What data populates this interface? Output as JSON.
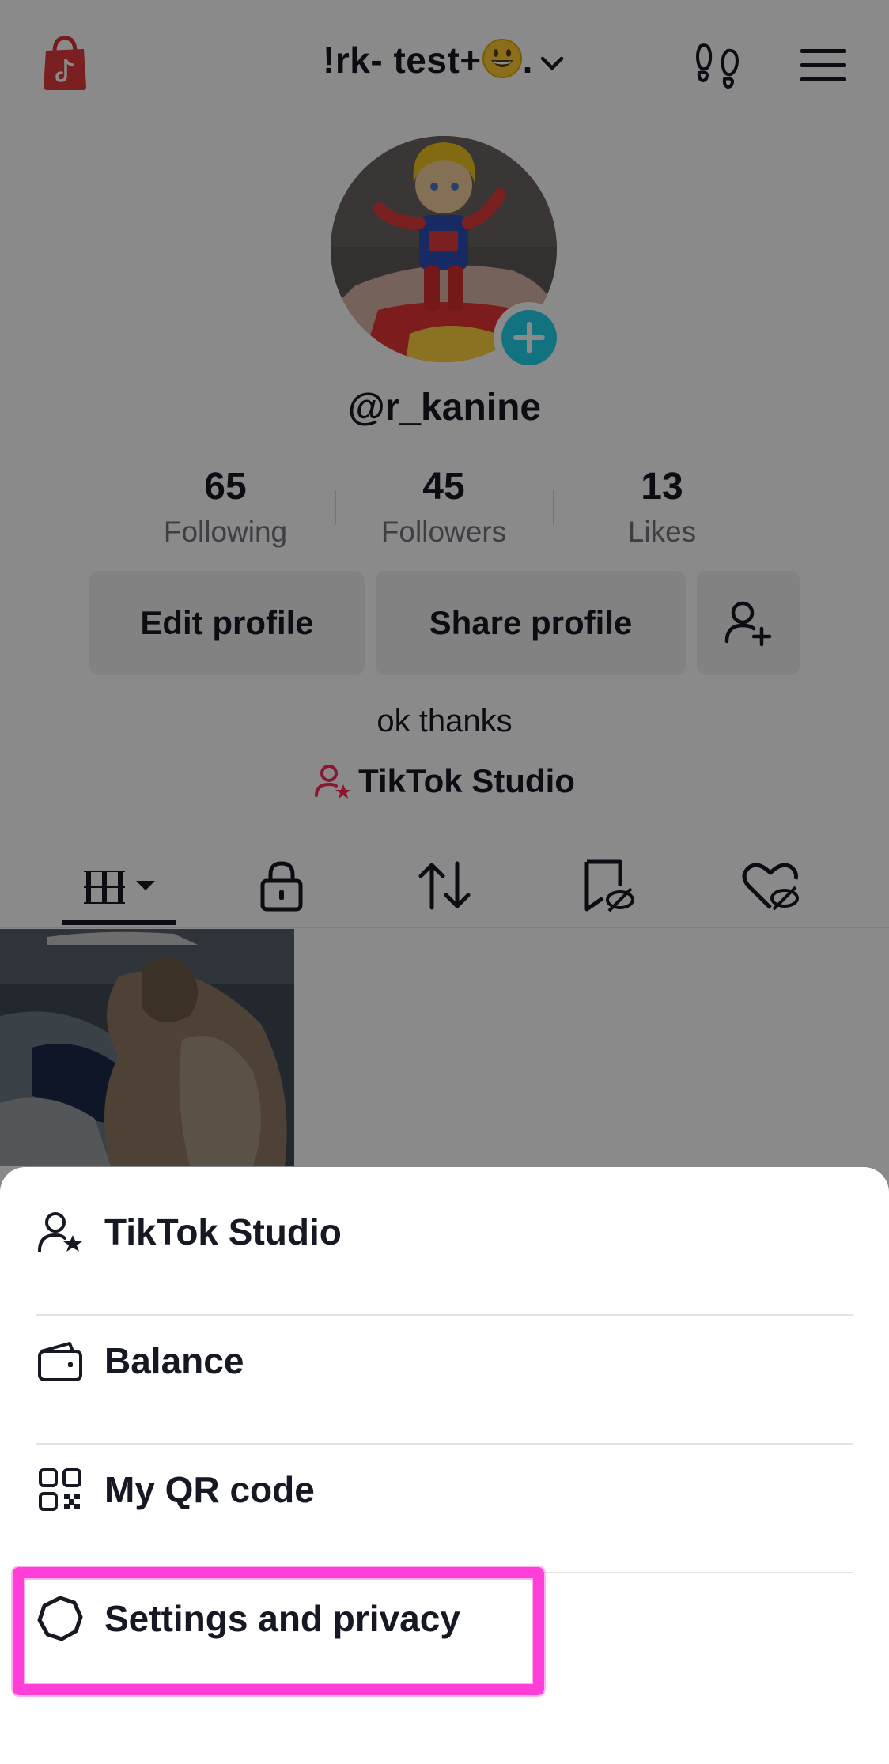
{
  "topbar": {
    "account_name": "!rk- test+",
    "account_suffix": "."
  },
  "profile": {
    "username": "@r_kanine",
    "stats": [
      {
        "value": "65",
        "label": "Following"
      },
      {
        "value": "45",
        "label": "Followers"
      },
      {
        "value": "13",
        "label": "Likes"
      }
    ],
    "edit_label": "Edit profile",
    "share_label": "Share profile",
    "bio": "ok thanks",
    "studio_link": "TikTok Studio"
  },
  "menu": {
    "items": [
      {
        "label": "TikTok Studio",
        "icon": "person-star-icon"
      },
      {
        "label": "Balance",
        "icon": "wallet-icon"
      },
      {
        "label": "My QR code",
        "icon": "qr-code-icon"
      },
      {
        "label": "Settings and privacy",
        "icon": "gear-icon"
      }
    ]
  },
  "colors": {
    "accent_teal": "#20d5ec",
    "brand_red": "#fe2c55",
    "highlight_magenta": "#ff3ed8"
  }
}
